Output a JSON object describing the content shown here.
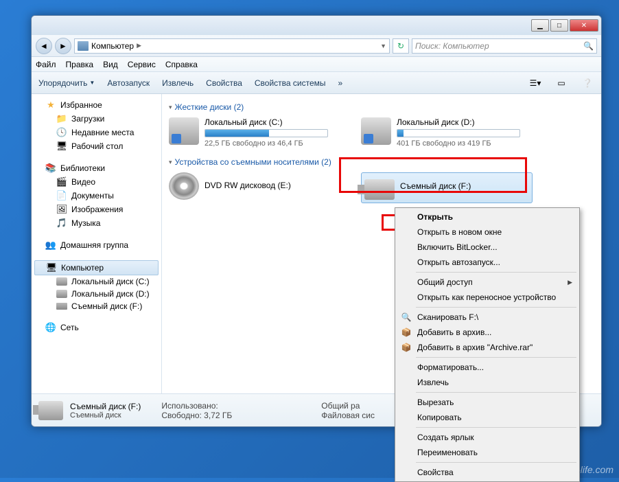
{
  "titlebar": {
    "min": "▁",
    "max": "□",
    "close": "✕"
  },
  "nav": {
    "location": "Компьютер",
    "search_placeholder": "Поиск: Компьютер"
  },
  "menubar": [
    "Файл",
    "Правка",
    "Вид",
    "Сервис",
    "Справка"
  ],
  "toolbar": {
    "organize": "Упорядочить",
    "autoplay": "Автозапуск",
    "eject": "Извлечь",
    "properties": "Свойства",
    "sysprops": "Свойства системы",
    "more": "»"
  },
  "sidebar": {
    "favorites": {
      "label": "Избранное",
      "items": [
        "Загрузки",
        "Недавние места",
        "Рабочий стол"
      ]
    },
    "libraries": {
      "label": "Библиотеки",
      "items": [
        "Видео",
        "Документы",
        "Изображения",
        "Музыка"
      ]
    },
    "homegroup": "Домашняя группа",
    "computer": {
      "label": "Компьютер",
      "items": [
        "Локальный диск (C:)",
        "Локальный диск (D:)",
        "Съемный диск (F:)"
      ]
    },
    "network": "Сеть"
  },
  "content": {
    "hdd_header": "Жесткие диски (2)",
    "removable_header": "Устройства со съемными носителями (2)",
    "drive_c": {
      "name": "Локальный диск (C:)",
      "sub": "22,5 ГБ свободно из 46,4 ГБ",
      "fill": 52
    },
    "drive_d": {
      "name": "Локальный диск (D:)",
      "sub": "401 ГБ свободно из 419 ГБ",
      "fill": 5
    },
    "dvd": {
      "name": "DVD RW дисковод (E:)"
    },
    "usb": {
      "name": "Съемный диск (F:)"
    }
  },
  "context": {
    "open": "Открыть",
    "open_new": "Открыть в новом окне",
    "bitlocker": "Включить BitLocker...",
    "open_autoplay": "Открыть автозапуск...",
    "sharing": "Общий доступ",
    "portable": "Открыть как переносное устройство",
    "scan": "Сканировать F:\\",
    "add_archive": "Добавить в архив...",
    "add_archive_rar": "Добавить в архив \"Archive.rar\"",
    "format": "Форматировать...",
    "eject": "Извлечь",
    "cut": "Вырезать",
    "copy": "Копировать",
    "shortcut": "Создать ярлык",
    "rename": "Переименовать",
    "props": "Свойства"
  },
  "details": {
    "name": "Съемный диск (F:)",
    "type": "Съемный диск",
    "used_label": "Использовано:",
    "free_label": "Свободно:",
    "free": "3,72 ГБ",
    "total_label": "Общий ра",
    "fs_label": "Файловая сис"
  },
  "watermark": "user-life.com"
}
